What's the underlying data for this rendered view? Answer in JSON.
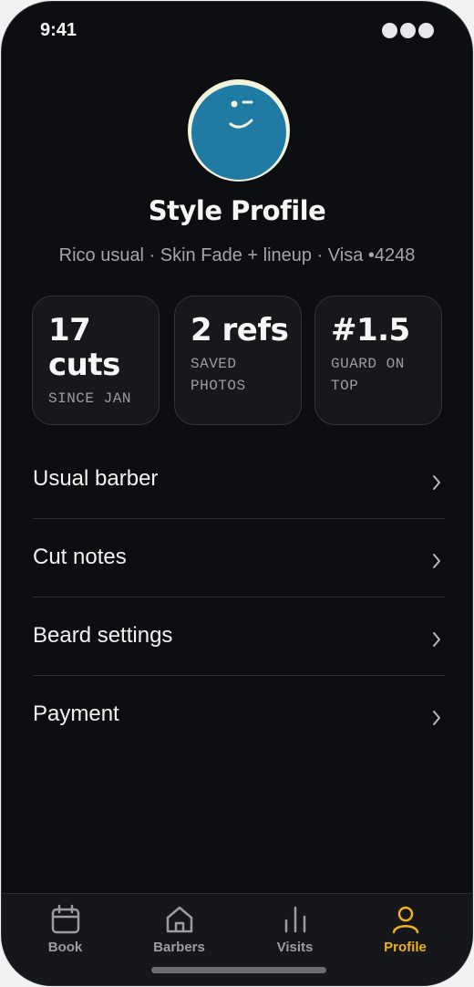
{
  "status_bar": {
    "time": "9:41"
  },
  "profile": {
    "title": "Style Profile",
    "subtitle": "Rico usual · Skin Fade + lineup · Visa •4248"
  },
  "stats": [
    {
      "value": "17\ncuts",
      "label": "SINCE JAN"
    },
    {
      "value": "2 refs",
      "label": "SAVED\nPHOTOS"
    },
    {
      "value": "#1.5",
      "label": "GUARD ON\nTOP"
    }
  ],
  "menu": [
    {
      "label": "Usual barber"
    },
    {
      "label": "Cut notes"
    },
    {
      "label": "Beard settings"
    },
    {
      "label": "Payment"
    }
  ],
  "tabs": [
    {
      "label": "Book",
      "icon": "calendar-icon"
    },
    {
      "label": "Barbers",
      "icon": "house-icon"
    },
    {
      "label": "Visits",
      "icon": "bar-chart-icon"
    },
    {
      "label": "Profile",
      "icon": "person-icon",
      "active": true
    }
  ],
  "colors": {
    "background": "#0d0e11",
    "accent": "#f2b01e",
    "avatar": "#1f7ba3"
  }
}
